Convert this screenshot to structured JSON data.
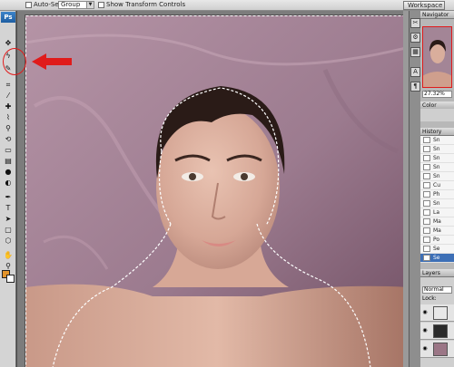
{
  "options_bar": {
    "auto_select_label": "Auto-Select:",
    "auto_select_value": "Group",
    "transform_label": "Show Transform Controls",
    "workspace_label": "Workspace"
  },
  "toolbox": {
    "logo": "Ps",
    "tools": [
      {
        "name": "move-tool-icon",
        "glyph": "✥"
      },
      {
        "name": "lasso-tool-icon",
        "glyph": "ϟ"
      },
      {
        "name": "quick-selection-tool-icon",
        "glyph": "✎"
      },
      {
        "name": "crop-tool-icon",
        "glyph": "⌗"
      },
      {
        "name": "eyedropper-tool-icon",
        "glyph": "⁄"
      },
      {
        "name": "healing-brush-tool-icon",
        "glyph": "✚"
      },
      {
        "name": "brush-tool-icon",
        "glyph": "⌇"
      },
      {
        "name": "clone-stamp-tool-icon",
        "glyph": "⚲"
      },
      {
        "name": "history-brush-tool-icon",
        "glyph": "⟲"
      },
      {
        "name": "eraser-tool-icon",
        "glyph": "▭"
      },
      {
        "name": "gradient-tool-icon",
        "glyph": "▤"
      },
      {
        "name": "blur-tool-icon",
        "glyph": "●"
      },
      {
        "name": "dodge-tool-icon",
        "glyph": "◐"
      },
      {
        "name": "pen-tool-icon",
        "glyph": "✒"
      },
      {
        "name": "type-tool-icon",
        "glyph": "T"
      },
      {
        "name": "path-selection-tool-icon",
        "glyph": "➤"
      },
      {
        "name": "shape-tool-icon",
        "glyph": "▢"
      },
      {
        "name": "3d-tool-icon",
        "glyph": "⬡"
      },
      {
        "name": "hand-tool-icon",
        "glyph": "✋"
      },
      {
        "name": "zoom-tool-icon",
        "glyph": "⚲"
      }
    ],
    "foreground_color": "#e3942b",
    "background_color": "#ffffff"
  },
  "panels": {
    "navigator_tab": "Navigator",
    "zoom_value": "27.32%",
    "color_tab": "Color",
    "history_tab": "History",
    "history_items": [
      "Sn",
      "Sn",
      "Sn",
      "Sn",
      "Sn",
      "Cu",
      "Ph",
      "Sn",
      "La",
      "Ma",
      "Ma",
      "Po",
      "Se",
      "Se"
    ],
    "history_active_index": 13,
    "layers_tab": "Layers",
    "layers_mode": "Normal",
    "layers_lock_label": "Lock:"
  },
  "colors": {
    "annotation": "#e01b1b",
    "backdrop": "#a38596"
  }
}
